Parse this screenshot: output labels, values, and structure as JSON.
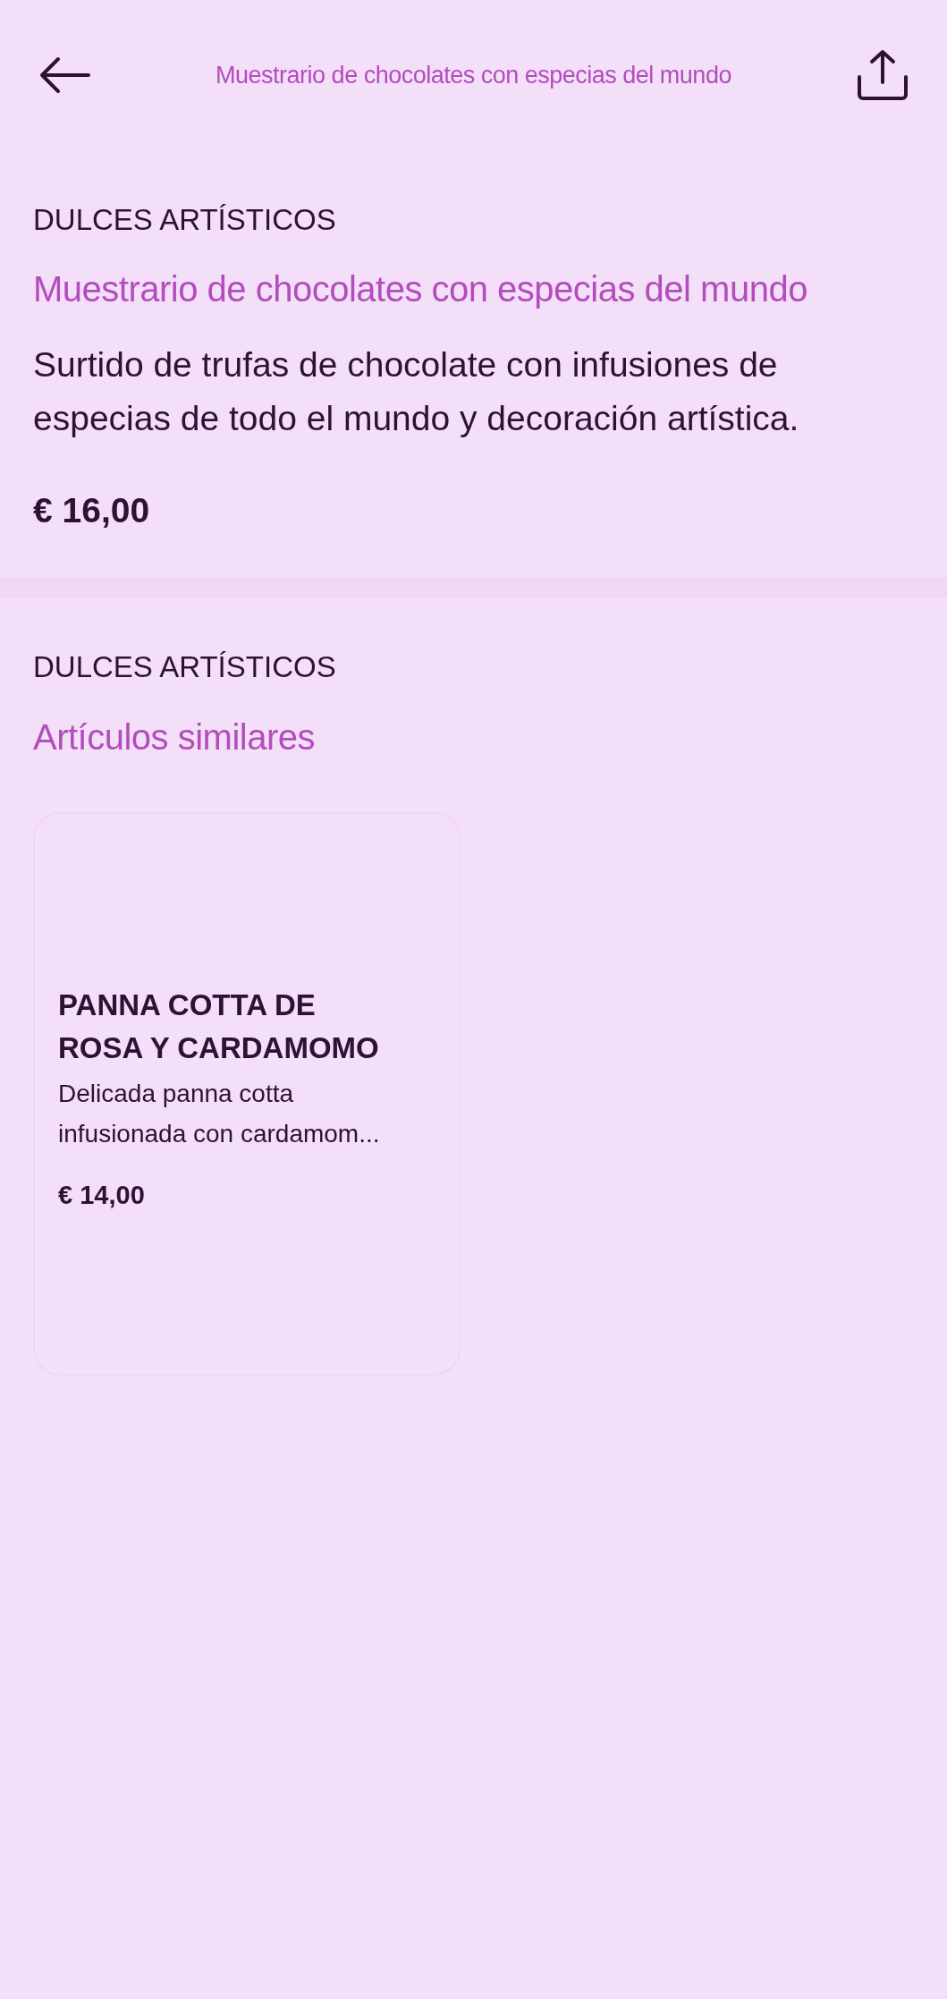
{
  "header": {
    "title": "Muestrario de chocolates con especias del mundo"
  },
  "product": {
    "category": "DULCES ARTÍSTICOS",
    "title": "Muestrario de chocolates con especias del mundo",
    "description": "Surtido de trufas de chocolate con infusiones de especias de todo el mundo y decoración artística.",
    "price": "€ 16,00"
  },
  "similar": {
    "category": "DULCES ARTÍSTICOS",
    "heading": "Artículos similares",
    "items": [
      {
        "title": "PANNA COTTA DE ROSA Y CARDAMOMO",
        "description": "Delicada panna cotta infusionada con cardamom...",
        "price": "€ 14,00"
      }
    ]
  }
}
